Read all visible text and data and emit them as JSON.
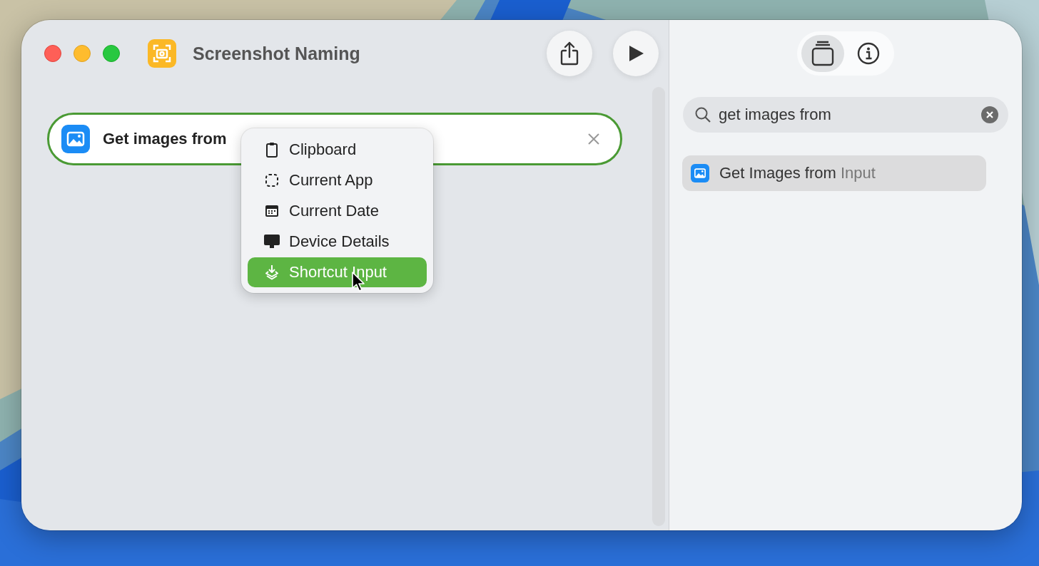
{
  "window": {
    "title": "Screenshot Naming"
  },
  "action": {
    "label": "Get images from"
  },
  "menu": {
    "items": [
      {
        "label": "Clipboard",
        "kind": "clipboard",
        "selected": false
      },
      {
        "label": "Current App",
        "kind": "dashed-square",
        "selected": false
      },
      {
        "label": "Current Date",
        "kind": "calendar",
        "selected": false
      },
      {
        "label": "Device Details",
        "kind": "display",
        "selected": false
      },
      {
        "label": "Shortcut Input",
        "kind": "stack",
        "selected": true
      }
    ]
  },
  "sidebar": {
    "tabs": [
      {
        "kind": "library",
        "selected": true
      },
      {
        "kind": "info",
        "selected": false
      }
    ],
    "search": {
      "value": "get images from"
    },
    "results": [
      {
        "match": "Get Images from",
        "rest": "Input",
        "selected": true
      }
    ]
  }
}
